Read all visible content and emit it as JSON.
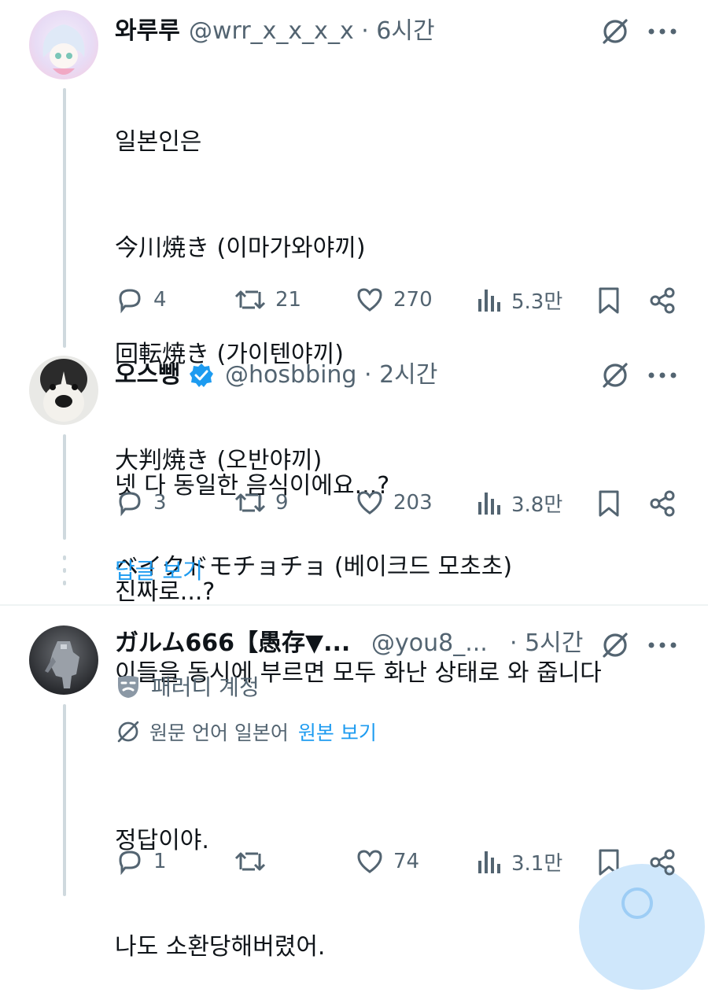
{
  "tweets": [
    {
      "name": "와루루",
      "handle": "@wrr_x_x_x_x · 6시간",
      "lines": [
        "일본인은",
        "今川焼き (이마가와야끼)",
        "回転焼き (가이텐야끼)",
        "大判焼き (오반야끼)",
        "ベイクドモチョチョ (베이크드 모초초)",
        "이들을 동시에 부르면 모두 화난 상태로 와 줍니다"
      ],
      "replies": "4",
      "retweets": "21",
      "likes": "270",
      "views": "5.3만"
    },
    {
      "name": "오스뺑",
      "handle": "@hosbbing · 2시간",
      "verified": true,
      "lines": [
        "넷 다 동일한 음식이에요...?",
        "진짜로...?"
      ],
      "replies": "3",
      "retweets": "9",
      "likes": "203",
      "views": "3.8만"
    },
    {
      "name": "ガルム666【愚存▼...",
      "handle": "@you8_...",
      "time": "· 5시간",
      "parody_label": "패러디 계정",
      "translated_from": "원문 언어 일본어",
      "show_original": "원본 보기",
      "lines": [
        "정답이야.",
        "나도 소환당해버렸어."
      ],
      "replies": "1",
      "retweets": "",
      "likes": "74",
      "views": "3.1만"
    }
  ],
  "show_replies": "답글 보기",
  "colors": {
    "accent": "#1d9bf0",
    "muted": "#536471",
    "line": "#cfd9de"
  }
}
